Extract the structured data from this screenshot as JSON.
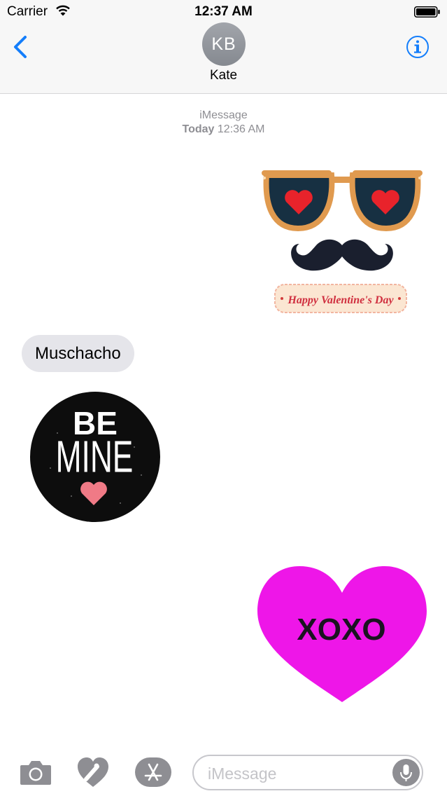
{
  "status_bar": {
    "carrier": "Carrier",
    "time": "12:37 AM"
  },
  "header": {
    "avatar_initials": "KB",
    "contact_name": "Kate"
  },
  "thread": {
    "service": "iMessage",
    "date_label": "Today",
    "time": "12:36 AM",
    "messages": [
      {
        "type": "sticker",
        "side": "outgoing",
        "text": "Happy Valentine's Day"
      },
      {
        "type": "text",
        "side": "incoming",
        "text": "Muschacho"
      },
      {
        "type": "sticker",
        "side": "incoming",
        "line1": "BE",
        "line2": "MINE"
      },
      {
        "type": "sticker",
        "side": "outgoing",
        "text": "XOXO"
      }
    ]
  },
  "composer": {
    "placeholder": "iMessage"
  },
  "colors": {
    "accent": "#147efb",
    "bubble_incoming": "#e5e5ea",
    "heart_sticker": "#ee16e8"
  },
  "icons": [
    "wifi-icon",
    "battery-icon",
    "back-chevron-icon",
    "info-icon",
    "camera-icon",
    "digital-touch-icon",
    "app-store-icon",
    "microphone-icon"
  ]
}
